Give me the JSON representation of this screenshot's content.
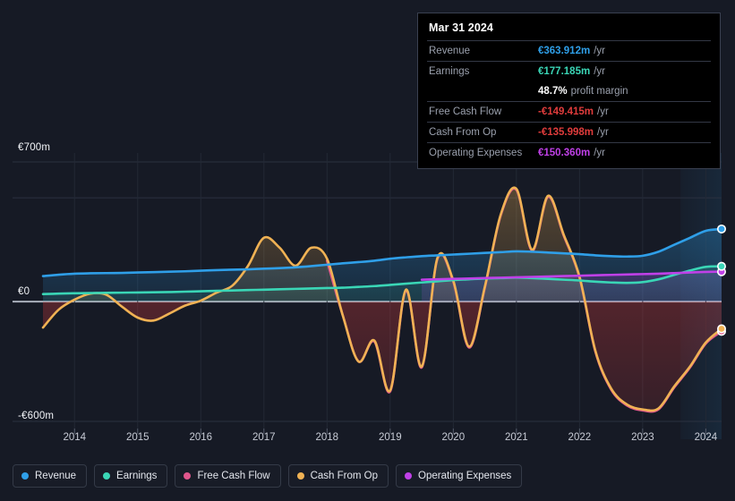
{
  "tooltip": {
    "title": "Mar 31 2024",
    "rows": [
      {
        "label": "Revenue",
        "value": "€363.912m",
        "unit": "/yr",
        "color": "#2f9fe8"
      },
      {
        "label": "Earnings",
        "value": "€177.185m",
        "unit": "/yr",
        "color": "#3ad6b6"
      },
      {
        "label": "",
        "value": "48.7%",
        "unit": "profit margin",
        "color": "#ffffff",
        "sub": true
      },
      {
        "label": "Free Cash Flow",
        "value": "-€149.415m",
        "unit": "/yr",
        "color": "#e03c3c"
      },
      {
        "label": "Cash From Op",
        "value": "-€135.998m",
        "unit": "/yr",
        "color": "#e03c3c"
      },
      {
        "label": "Operating Expenses",
        "value": "€150.360m",
        "unit": "/yr",
        "color": "#c040e8"
      }
    ]
  },
  "legend": {
    "items": [
      {
        "label": "Revenue",
        "color": "#2f9fe8"
      },
      {
        "label": "Earnings",
        "color": "#3ad6b6"
      },
      {
        "label": "Free Cash Flow",
        "color": "#e0568c"
      },
      {
        "label": "Cash From Op",
        "color": "#f0b254"
      },
      {
        "label": "Operating Expenses",
        "color": "#c040e8"
      }
    ]
  },
  "axis": {
    "y_top": "€700m",
    "y_zero": "€0",
    "y_bottom": "-€600m"
  },
  "chart_data": {
    "type": "line",
    "title": "",
    "xlabel": "",
    "ylabel": "",
    "currency": "EUR",
    "units": "millions per year",
    "ylim": [
      -600,
      700
    ],
    "grid": true,
    "legend_position": "bottom",
    "highlight_band_from": "2023.6",
    "x_tick_labels": [
      "2014",
      "2015",
      "2016",
      "2017",
      "2018",
      "2019",
      "2020",
      "2021",
      "2022",
      "2023",
      "2024"
    ],
    "x": [
      2013.5,
      2013.75,
      2014,
      2014.25,
      2014.5,
      2014.75,
      2015,
      2015.25,
      2015.5,
      2015.75,
      2016,
      2016.25,
      2016.5,
      2016.75,
      2017,
      2017.25,
      2017.5,
      2017.75,
      2018,
      2018.25,
      2018.5,
      2018.75,
      2019,
      2019.25,
      2019.5,
      2019.75,
      2020,
      2020.25,
      2020.5,
      2020.75,
      2021,
      2021.25,
      2021.5,
      2021.75,
      2022,
      2022.25,
      2022.5,
      2022.75,
      2023,
      2023.25,
      2023.5,
      2023.75,
      2024,
      2024.25
    ],
    "series": [
      {
        "name": "Revenue",
        "color": "#2f9fe8",
        "values": [
          128,
          135,
          140,
          142,
          143,
          144,
          146,
          148,
          150,
          152,
          155,
          158,
          160,
          162,
          165,
          168,
          172,
          178,
          185,
          192,
          198,
          205,
          215,
          222,
          228,
          232,
          236,
          240,
          244,
          248,
          252,
          250,
          246,
          242,
          238,
          232,
          228,
          226,
          230,
          250,
          285,
          320,
          355,
          364
        ]
      },
      {
        "name": "Earnings",
        "color": "#3ad6b6",
        "values": [
          38,
          40,
          42,
          43,
          44,
          45,
          46,
          47,
          48,
          50,
          52,
          54,
          56,
          58,
          60,
          62,
          64,
          66,
          68,
          70,
          74,
          78,
          84,
          90,
          96,
          102,
          108,
          112,
          116,
          118,
          120,
          118,
          114,
          110,
          106,
          100,
          96,
          94,
          98,
          112,
          134,
          156,
          174,
          177
        ]
      },
      {
        "name": "Free Cash Flow",
        "color": "#e0568c",
        "values": [
          null,
          null,
          null,
          null,
          null,
          null,
          null,
          null,
          null,
          null,
          null,
          null,
          null,
          null,
          null,
          null,
          null,
          null,
          205,
          -70,
          -300,
          -200,
          -450,
          55,
          -330,
          215,
          100,
          -230,
          70,
          430,
          560,
          255,
          525,
          330,
          120,
          -250,
          -440,
          -520,
          -545,
          -540,
          -430,
          -330,
          -210,
          -149
        ]
      },
      {
        "name": "Cash From Op",
        "color": "#f0b254",
        "values": [
          -130,
          -40,
          10,
          40,
          35,
          -25,
          -80,
          -95,
          -60,
          -20,
          5,
          45,
          80,
          180,
          320,
          270,
          180,
          270,
          215,
          -70,
          -300,
          -195,
          -445,
          60,
          -325,
          220,
          105,
          -225,
          75,
          435,
          565,
          260,
          530,
          335,
          125,
          -245,
          -435,
          -515,
          -540,
          -535,
          -425,
          -325,
          -205,
          -136
        ]
      },
      {
        "name": "Operating Expenses",
        "color": "#c040e8",
        "values": [
          null,
          null,
          null,
          null,
          null,
          null,
          null,
          null,
          null,
          null,
          null,
          null,
          null,
          null,
          null,
          null,
          null,
          null,
          null,
          null,
          null,
          null,
          null,
          null,
          110,
          112,
          114,
          116,
          118,
          120,
          122,
          124,
          126,
          128,
          130,
          132,
          134,
          136,
          138,
          140,
          143,
          146,
          149,
          150
        ]
      }
    ],
    "latest_point_labels": {
      "Revenue": "€363.912m",
      "Earnings": "€177.185m",
      "Free Cash Flow": "-€149.415m",
      "Cash From Op": "-€135.998m",
      "Operating Expenses": "€150.360m"
    }
  },
  "colors": {
    "background": "#161a25",
    "grid": "#2b3140",
    "zero_line": "#aab0bc",
    "revenue": "#2f9fe8",
    "earnings": "#3ad6b6",
    "free_cash_flow": "#e0568c",
    "cash_from_op": "#f0b254",
    "operating_expenses": "#c040e8",
    "negative": "#e03c3c"
  }
}
